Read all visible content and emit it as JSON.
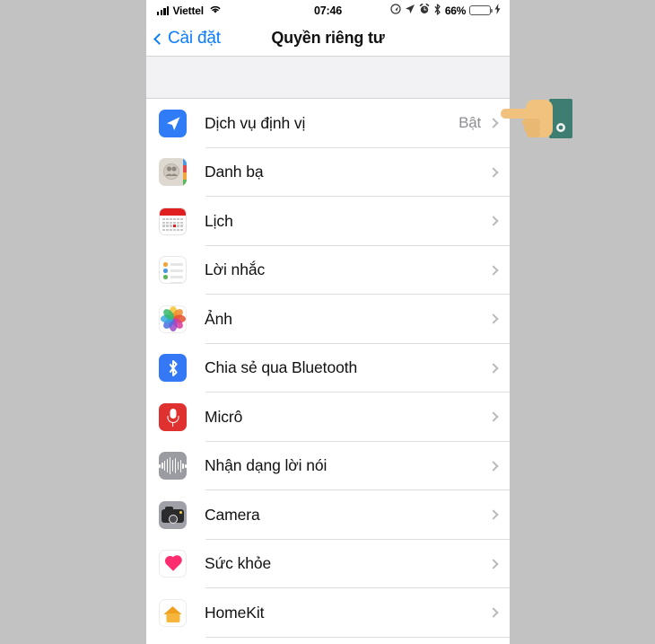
{
  "status_bar": {
    "signal_icon": "cellular-signal-icon",
    "carrier": "Viettel",
    "wifi_icon": "wifi-icon",
    "time": "07:46",
    "icons": [
      "location-services-icon",
      "navigation-arrow-icon",
      "alarm-clock-icon",
      "bluetooth-icon"
    ],
    "battery_percent": "66%",
    "battery_level": 66,
    "battery_fill_color": "#4cd964",
    "charging_icon": "lightning-bolt-icon"
  },
  "nav_bar": {
    "back_label": "Cài đặt",
    "back_icon": "chevron-left-icon",
    "title": "Quyền riêng tư"
  },
  "colors": {
    "ios_blue": "#0a7cff",
    "page_background": "#c2c2c2",
    "separator": "#dedee1",
    "value_gray": "#8e8e93",
    "gap_background": "#f2f2f5"
  },
  "list": {
    "rows": [
      {
        "id": "location-services",
        "label": "Dịch vụ định vị",
        "value": "Bật",
        "icon": "location-arrow-icon",
        "icon_class": "ic-location"
      },
      {
        "id": "contacts",
        "label": "Danh bạ",
        "value": "",
        "icon": "contacts-icon",
        "icon_class": "ic-contacts"
      },
      {
        "id": "calendar",
        "label": "Lịch",
        "value": "",
        "icon": "calendar-icon",
        "icon_class": "ic-calendar"
      },
      {
        "id": "reminders",
        "label": "Lời nhắc",
        "value": "",
        "icon": "reminders-icon",
        "icon_class": "ic-reminders"
      },
      {
        "id": "photos",
        "label": "Ảnh",
        "value": "",
        "icon": "photos-icon",
        "icon_class": "ic-photos"
      },
      {
        "id": "bluetooth-sharing",
        "label": "Chia sẻ qua Bluetooth",
        "value": "",
        "icon": "bluetooth-icon",
        "icon_class": "ic-bt"
      },
      {
        "id": "microphone",
        "label": "Micrô",
        "value": "",
        "icon": "microphone-icon",
        "icon_class": "ic-mic"
      },
      {
        "id": "speech-recognition",
        "label": "Nhận dạng lời nói",
        "value": "",
        "icon": "speech-waveform-icon",
        "icon_class": "ic-speech"
      },
      {
        "id": "camera",
        "label": "Camera",
        "value": "",
        "icon": "camera-icon",
        "icon_class": "ic-camera"
      },
      {
        "id": "health",
        "label": "Sức khỏe",
        "value": "",
        "icon": "heart-icon",
        "icon_class": "ic-health"
      },
      {
        "id": "homekit",
        "label": "HomeKit",
        "value": "",
        "icon": "house-icon",
        "icon_class": "ic-home"
      }
    ],
    "disclosure_icon": "chevron-right-icon"
  },
  "overlay": {
    "cursor_icon": "pointing-hand-cursor",
    "hand_color": "#f0c27e",
    "sleeve_color": "#3d7d72"
  }
}
